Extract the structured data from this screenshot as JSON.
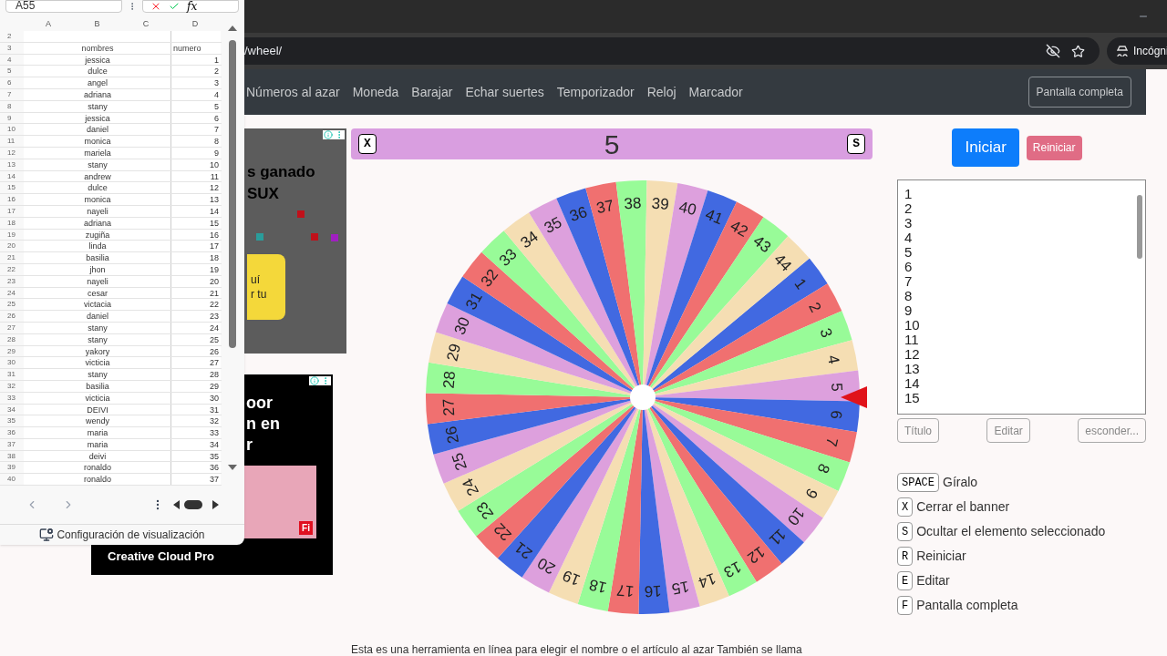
{
  "browser": {
    "address": "/wheel/",
    "profile": "Incógni"
  },
  "nav": {
    "items": [
      "Números al azar",
      "Moneda",
      "Barajar",
      "Echar suertes",
      "Temporizador",
      "Reloj",
      "Marcador"
    ],
    "fullscreen": "Pantalla completa"
  },
  "spreadsheet": {
    "cell_ref": "A55",
    "formula_icon": "fx",
    "columns": [
      "A",
      "B",
      "C",
      "D"
    ],
    "rows": [
      {
        "n": "2"
      },
      {
        "n": "3",
        "name": "nombres",
        "num": "numero",
        "kind": "header"
      },
      {
        "n": "4",
        "name": "jessica",
        "num": "1"
      },
      {
        "n": "5",
        "name": "dulce",
        "num": "2"
      },
      {
        "n": "6",
        "name": "angel",
        "num": "3"
      },
      {
        "n": "7",
        "name": "adriana",
        "num": "4"
      },
      {
        "n": "8",
        "name": "stany",
        "num": "5"
      },
      {
        "n": "9",
        "name": "jessica",
        "num": "6"
      },
      {
        "n": "10",
        "name": "daniel",
        "num": "7"
      },
      {
        "n": "11",
        "name": "monica",
        "num": "8"
      },
      {
        "n": "12",
        "name": "mariela",
        "num": "9"
      },
      {
        "n": "13",
        "name": "stany",
        "num": "10"
      },
      {
        "n": "14",
        "name": "andrew",
        "num": "11"
      },
      {
        "n": "15",
        "name": "dulce",
        "num": "12"
      },
      {
        "n": "16",
        "name": "monica",
        "num": "13"
      },
      {
        "n": "17",
        "name": "nayeli",
        "num": "14"
      },
      {
        "n": "18",
        "name": "adriana",
        "num": "15"
      },
      {
        "n": "19",
        "name": "zugiña",
        "num": "16"
      },
      {
        "n": "20",
        "name": "linda",
        "num": "17"
      },
      {
        "n": "21",
        "name": "basilia",
        "num": "18"
      },
      {
        "n": "22",
        "name": "jhon",
        "num": "19"
      },
      {
        "n": "23",
        "name": "nayeli",
        "num": "20"
      },
      {
        "n": "24",
        "name": "cesar",
        "num": "21"
      },
      {
        "n": "25",
        "name": "victacia",
        "num": "22"
      },
      {
        "n": "26",
        "name": "daniel",
        "num": "23"
      },
      {
        "n": "27",
        "name": "stany",
        "num": "24"
      },
      {
        "n": "28",
        "name": "stany",
        "num": "25"
      },
      {
        "n": "29",
        "name": "yakory",
        "num": "26"
      },
      {
        "n": "30",
        "name": "victicia",
        "num": "27"
      },
      {
        "n": "31",
        "name": "stany",
        "num": "28"
      },
      {
        "n": "32",
        "name": "basilia",
        "num": "29"
      },
      {
        "n": "33",
        "name": "victicia",
        "num": "30"
      },
      {
        "n": "34",
        "name": "DEIVI",
        "num": "31"
      },
      {
        "n": "35",
        "name": "wendy",
        "num": "32"
      },
      {
        "n": "36",
        "name": "maria",
        "num": "33"
      },
      {
        "n": "37",
        "name": "maria",
        "num": "34"
      },
      {
        "n": "38",
        "name": "deivi",
        "num": "35"
      },
      {
        "n": "39",
        "name": "ronaldo",
        "num": "36"
      },
      {
        "n": "40",
        "name": "ronaldo",
        "num": "37"
      }
    ],
    "footer": "Configuración de visualización"
  },
  "ads": [
    {
      "lines": [
        "s ganado",
        "SUX"
      ],
      "button_lines": [
        "uí",
        "r tu"
      ]
    },
    {
      "lines": [
        "oor",
        "n en",
        "r"
      ],
      "brand": "Creative Cloud Pro",
      "badge": "Fi"
    }
  ],
  "wheel": {
    "close_key": "X",
    "selected": "5",
    "hide_key": "S",
    "segments": [
      {
        "label": "1"
      },
      {
        "label": "2"
      },
      {
        "label": "3"
      },
      {
        "label": "4"
      },
      {
        "label": "5"
      },
      {
        "label": "6"
      },
      {
        "label": "7"
      },
      {
        "label": "8"
      },
      {
        "label": "9"
      },
      {
        "label": "10"
      },
      {
        "label": "11"
      },
      {
        "label": "12"
      },
      {
        "label": "13"
      },
      {
        "label": "14"
      },
      {
        "label": "15"
      },
      {
        "label": "16"
      },
      {
        "label": "17"
      },
      {
        "label": "18"
      },
      {
        "label": "19"
      },
      {
        "label": "20"
      },
      {
        "label": "21"
      },
      {
        "label": "22"
      },
      {
        "label": "23"
      },
      {
        "label": "24"
      },
      {
        "label": "25"
      },
      {
        "label": "26"
      },
      {
        "label": "27"
      },
      {
        "label": "28"
      },
      {
        "label": "29"
      },
      {
        "label": "30"
      },
      {
        "label": "31"
      },
      {
        "label": "32"
      },
      {
        "label": "33"
      },
      {
        "label": "34"
      },
      {
        "label": "35"
      },
      {
        "label": "36"
      },
      {
        "label": "37"
      },
      {
        "label": "38"
      },
      {
        "label": "39"
      },
      {
        "label": "40"
      },
      {
        "label": "41"
      },
      {
        "label": "42"
      },
      {
        "label": "43"
      },
      {
        "label": "44"
      }
    ]
  },
  "controls": {
    "start": "Iniciar",
    "reset": "Reiniciar",
    "list": [
      "1",
      "2",
      "3",
      "4",
      "5",
      "6",
      "7",
      "8",
      "9",
      "10",
      "11",
      "12",
      "13",
      "14",
      "15"
    ],
    "buttons": [
      "Título",
      "Editar",
      "esconder..."
    ]
  },
  "shortcuts": [
    {
      "key": "SPACE",
      "label": "Gíralo"
    },
    {
      "key": "X",
      "label": "Cerrar el banner"
    },
    {
      "key": "S",
      "label": "Ocultar el elemento seleccionado"
    },
    {
      "key": "R",
      "label": "Reiniciar"
    },
    {
      "key": "E",
      "label": "Editar"
    },
    {
      "key": "F",
      "label": "Pantalla completa"
    }
  ],
  "description": "Esta es una herramienta en línea para elegir el nombre o el artículo al azar También se llama"
}
